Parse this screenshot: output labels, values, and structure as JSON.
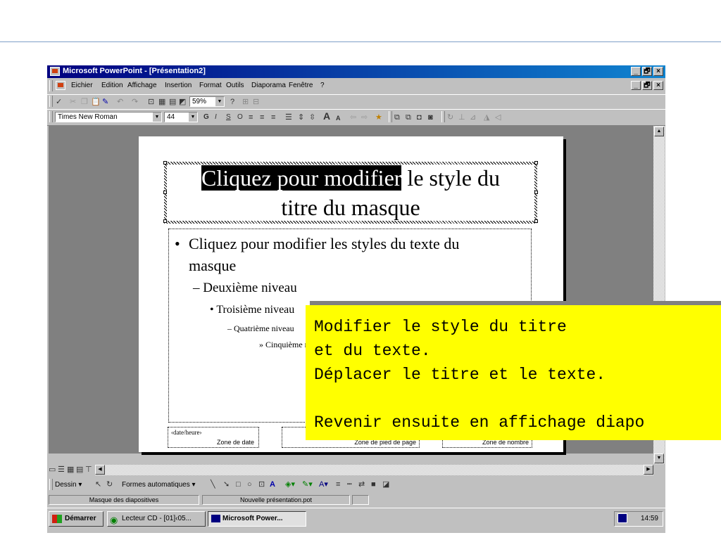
{
  "window": {
    "title": "Microsoft PowerPoint - [Présentation2]",
    "controls": [
      "_",
      "🗗",
      "×"
    ],
    "doc_controls": [
      "_",
      "🗗",
      "×"
    ]
  },
  "menu": [
    "Eichier",
    "Edition",
    "Affichage",
    "Insertion",
    "Format",
    "Outils",
    "Diaporama",
    "Fenêtre",
    "?"
  ],
  "toolbar": {
    "zoom": "59%",
    "font_name": "Times New Roman",
    "font_size": "44",
    "format_buttons": [
      "G",
      "I",
      "S",
      "O"
    ]
  },
  "slide": {
    "title_selected": "Cliquez pour modifier",
    "title_rest_line1": " le style du",
    "title_line2": "titre du masque",
    "body": {
      "level1_bullet": "•",
      "level1a": "Cliquez pour modifier les styles du texte du",
      "level1b": "masque",
      "level2": "– Deuxième niveau",
      "level3": "• Troisième niveau",
      "level4": "– Quatrième niveau",
      "level5": "» Cinquième niveau"
    },
    "footer": {
      "date_placeholder": "‹date/heure›",
      "date_label": "Zone de date",
      "footer_label": "Zone de pied de page",
      "number_label": "Zone de nombre"
    }
  },
  "callout": {
    "lines": [
      "Modifier le style du titre",
      "et du texte.",
      "Déplacer le titre et le texte.",
      "",
      "Revenir ensuite en affichage diapo"
    ]
  },
  "drawing": {
    "draw_label": "Dessin",
    "shapes_label": "Formes automatiques"
  },
  "status": {
    "pane1": "Masque des diapositives",
    "pane2": "Nouvelle présentation.pot"
  },
  "taskbar": {
    "start": "Démarrer",
    "task1": "Lecteur CD - [01]‹05...",
    "task2": "Microsoft Power...",
    "clock": "14:59"
  }
}
